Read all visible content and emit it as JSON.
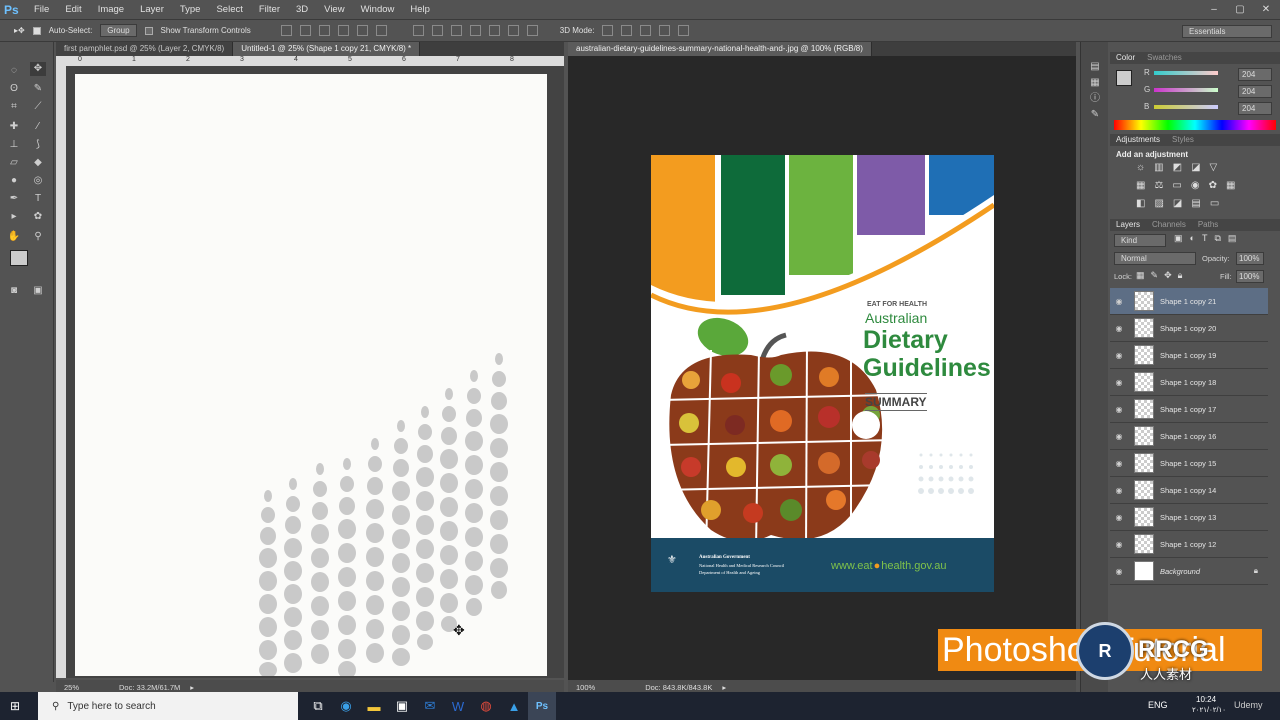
{
  "app": {
    "logo": "Ps",
    "menu": [
      "File",
      "Edit",
      "Image",
      "Layer",
      "Type",
      "Select",
      "Filter",
      "3D",
      "View",
      "Window",
      "Help"
    ],
    "window_controls": [
      "–",
      "▢",
      "✕"
    ]
  },
  "options_bar": {
    "auto_select_label": "Auto-Select:",
    "auto_select_value": "Group",
    "transform_controls_label": "Show Transform Controls",
    "mode_3d_label": "3D Mode:",
    "workspace": "Essentials"
  },
  "doc_left": {
    "tabs": [
      {
        "label": "first pamphlet.psd @ 25% (Layer 2, CMYK/8)",
        "active": false
      },
      {
        "label": "Untitled-1 @ 25% (Shape 1 copy 21, CMYK/8) *",
        "active": true
      }
    ],
    "zoom": "25%",
    "doc_size": "Doc: 33.2M/61.7M",
    "ruler_marks": [
      "0",
      "1",
      "2",
      "3",
      "4",
      "5",
      "6",
      "7",
      "8"
    ]
  },
  "doc_right": {
    "tab": "australian-dietary-guidelines-summary-national-health-and-.jpg @ 100% (RGB/8)",
    "zoom": "100%",
    "doc_size": "Doc: 843.8K/843.8K",
    "poster": {
      "kicker": "EAT FOR HEALTH",
      "line1": "Australian",
      "line2": "Dietary",
      "line3": "Guidelines",
      "summary": "SUMMARY",
      "gov1": "Australian Government",
      "gov2": "National Health and Medical Research Council",
      "gov3": "Department of Health and Ageing",
      "url_prefix": "www.eat",
      "url_suffix": "health.gov.au",
      "stripe_colors": [
        "#f39c1f",
        "#0e6b3a",
        "#6cb33f",
        "#7e5ba8",
        "#1f6fb5"
      ]
    }
  },
  "color_panel": {
    "tabs": [
      "Color",
      "Swatches"
    ],
    "channels": [
      {
        "label": "R",
        "value": "204"
      },
      {
        "label": "G",
        "value": "204"
      },
      {
        "label": "B",
        "value": "204"
      }
    ]
  },
  "adjustments_panel": {
    "tabs": [
      "Adjustments",
      "Styles"
    ],
    "heading": "Add an adjustment"
  },
  "layers_panel": {
    "tabs": [
      "Layers",
      "Channels",
      "Paths"
    ],
    "kind": "Kind",
    "blend_mode": "Normal",
    "opacity_label": "Opacity:",
    "opacity": "100%",
    "lock_label": "Lock:",
    "fill_label": "Fill:",
    "fill": "100%",
    "layers": [
      "Shape 1 copy 21",
      "Shape 1 copy 20",
      "Shape 1 copy 19",
      "Shape 1 copy 18",
      "Shape 1 copy 17",
      "Shape 1 copy 16",
      "Shape 1 copy 15",
      "Shape 1 copy 14",
      "Shape 1 copy 13",
      "Shape 1 copy 12",
      "Background"
    ]
  },
  "overlay": {
    "banner": "Photoshop Tutorial",
    "badge_line1": "RRCG",
    "badge_line2": "人人素材"
  },
  "taskbar": {
    "search_placeholder": "Type here to search",
    "lang": "ENG",
    "time": "10:24",
    "date": "۲۰۲۱/۰۲/۱۰",
    "brand": "Udemy"
  }
}
